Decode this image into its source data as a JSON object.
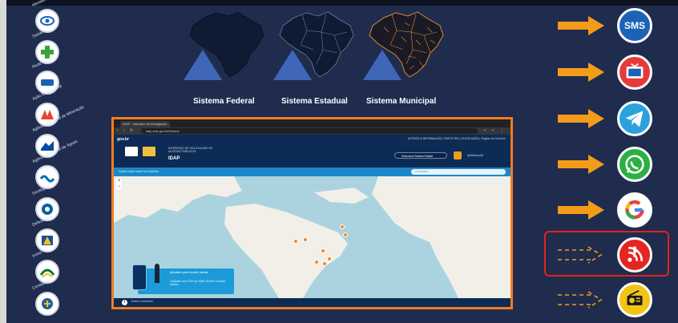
{
  "maps": [
    {
      "label": "Sistema Federal",
      "style": "federal"
    },
    {
      "label": "Sistema Estadual",
      "style": "estadual"
    },
    {
      "label": "Sistema Municipal",
      "style": "municipal"
    }
  ],
  "agencies": [
    {
      "name": "Ministério",
      "icon": "ministerio-logo-icon",
      "color": "#1b63b5"
    },
    {
      "name": "Saúde",
      "icon": "saude-cross-icon",
      "color": "#3aa33a"
    },
    {
      "name": "Rede SIGEO",
      "icon": "sigeo-logo-icon",
      "color": "#1b63b5"
    },
    {
      "name": "Ação Educacional",
      "icon": "anatel-logo-icon",
      "color": "#e8442e"
    },
    {
      "name": "Agência Nacional de Mineração",
      "icon": "anm-logo-icon",
      "color": "#0a4aa3"
    },
    {
      "name": "Agência Nacional de Águas",
      "icon": "ana-logo-icon",
      "color": "#0b6db8"
    },
    {
      "name": "Geológico",
      "icon": "cprm-logo-icon",
      "color": "#0b5ea8"
    },
    {
      "name": "Defesa Civil",
      "icon": "defesa-civil-logo-icon",
      "color": "#1e4d9a"
    },
    {
      "name": "Inmet",
      "icon": "inmet-logo-icon",
      "color": "#0f7a35"
    },
    {
      "name": "Censipam",
      "icon": "censipam-logo-icon",
      "color": "#1f5fa0"
    }
  ],
  "browser": {
    "tab_title": "IDAP - Interface de Divulgação...",
    "url": "idap.mdr.gov.br/#/home",
    "gov_label": "gov.br",
    "gov_links": "ACESSO À INFORMAÇÃO  |  PARTICIPE  |  LEGISLAÇÃO  |  Órgãos do Governo",
    "idap_subtitle": "INTERFACE DE DIVULGAÇÃO DE ALERTAS PÚBLICOS",
    "idap_title": "IDAP",
    "select_label": "Selecione Estado/Cidade",
    "social_label": "@defesacivil",
    "search_hint": "Saiba mais sobre os Alertas",
    "search_placeholder": "Pesquisar...",
    "promo_title": "Aplicativo para receber alertas",
    "promo_text": "Cadastre seu CEP por SMS 40199 e receba alertas",
    "footer_text": "Sobre a Interface"
  },
  "channels": [
    {
      "name": "SMS",
      "label": "SMS",
      "icon": "sms-icon",
      "bg": "#1c63b7",
      "ring": "#ffffff",
      "highlighted": false,
      "arrow": "solid"
    },
    {
      "name": "TV",
      "label": "",
      "icon": "tv-icon",
      "bg": "#e63a3a",
      "ring": "#ffffff",
      "highlighted": false,
      "arrow": "solid"
    },
    {
      "name": "Telegram",
      "label": "",
      "icon": "telegram-icon",
      "bg": "#2aa3dd",
      "ring": "#ffffff",
      "highlighted": false,
      "arrow": "solid"
    },
    {
      "name": "WhatsApp",
      "label": "",
      "icon": "whatsapp-icon",
      "bg": "#2bb042",
      "ring": "#ffffff",
      "highlighted": false,
      "arrow": "solid"
    },
    {
      "name": "Google",
      "label": "",
      "icon": "google-icon",
      "bg": "#ffffff",
      "ring": "#ffffff",
      "highlighted": false,
      "arrow": "solid"
    },
    {
      "name": "Alerta RSS",
      "label": "",
      "icon": "rss-alert-icon",
      "bg": "#e52521",
      "ring": "#ffffff",
      "highlighted": true,
      "arrow": "dashed"
    },
    {
      "name": "Rádio",
      "label": "",
      "icon": "radio-icon",
      "bg": "#f2c418",
      "ring": "#ffffff",
      "highlighted": false,
      "arrow": "dashed"
    }
  ],
  "colors": {
    "background": "#1f2c4e",
    "accent_orange": "#f39c19",
    "highlight_red": "#e2231a"
  }
}
